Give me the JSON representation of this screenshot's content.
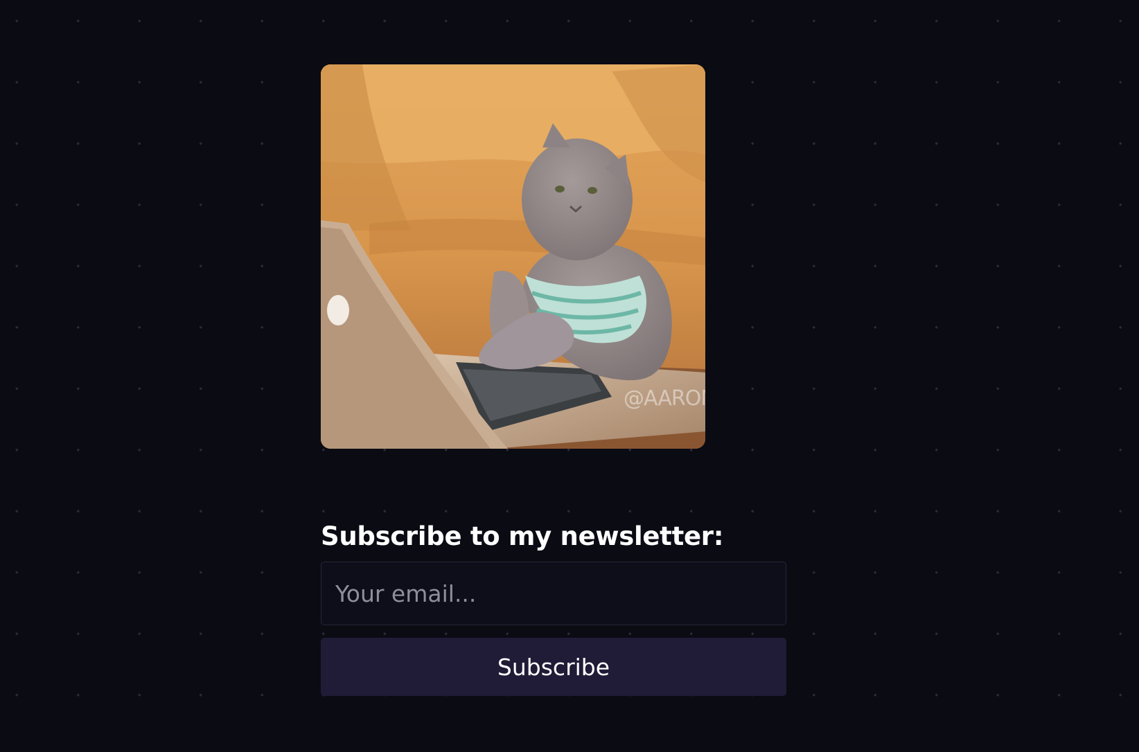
{
  "gif": {
    "watermark": "@AARON"
  },
  "newsletter": {
    "heading": "Subscribe to my newsletter:",
    "email_placeholder": "Your email...",
    "subscribe_label": "Subscribe"
  }
}
